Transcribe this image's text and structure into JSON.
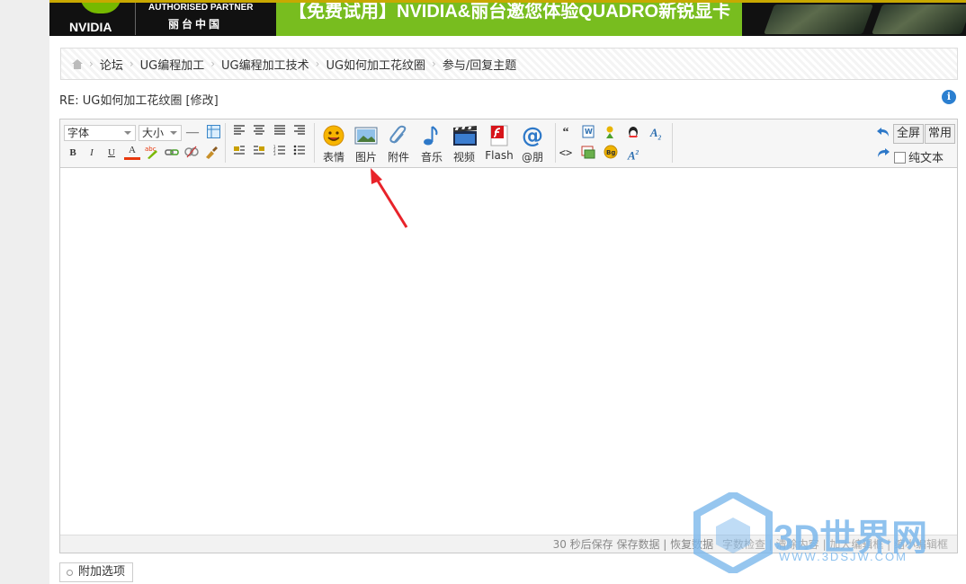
{
  "banner": {
    "brand": "NVIDIA",
    "partner_line": "AUTHORISED PARTNER",
    "partner_cn": "丽台中国",
    "promo": "【免费试用】NVIDIA&丽台邀您体验QUADRO新锐显卡"
  },
  "breadcrumb": [
    "论坛",
    "UG编程加工",
    "UG编程加工技术",
    "UG如何加工花纹圈",
    "参与/回复主题"
  ],
  "post_title": "RE: UG如何加工花纹圈",
  "edit_label": "[修改]",
  "info_icon": "i",
  "toolbar": {
    "font_select": "字体",
    "size_select": "大小",
    "format_buttons": [
      "B",
      "I",
      "U",
      "A"
    ],
    "big_buttons": [
      {
        "label": "表情",
        "icon": "smiley-icon"
      },
      {
        "label": "图片",
        "icon": "image-icon"
      },
      {
        "label": "附件",
        "icon": "paperclip-icon"
      },
      {
        "label": "音乐",
        "icon": "music-note-icon"
      },
      {
        "label": "视频",
        "icon": "video-icon"
      },
      {
        "label": "Flash",
        "icon": "flash-icon"
      },
      {
        "label": "@朋",
        "icon": "at-icon"
      }
    ],
    "fullscreen": "全屏",
    "common": "常用",
    "plain_text": "纯文本"
  },
  "statusbar": {
    "autosave": "30 秒后保存 保存数据 | 恢复数据",
    "obscured": "字数检查 | 清除内容 | 加大编辑框 | 缩小编辑框"
  },
  "extra_options": "附加选项",
  "watermark": {
    "text": "3D世界网",
    "url": "WWW.3DSJW.COM"
  }
}
